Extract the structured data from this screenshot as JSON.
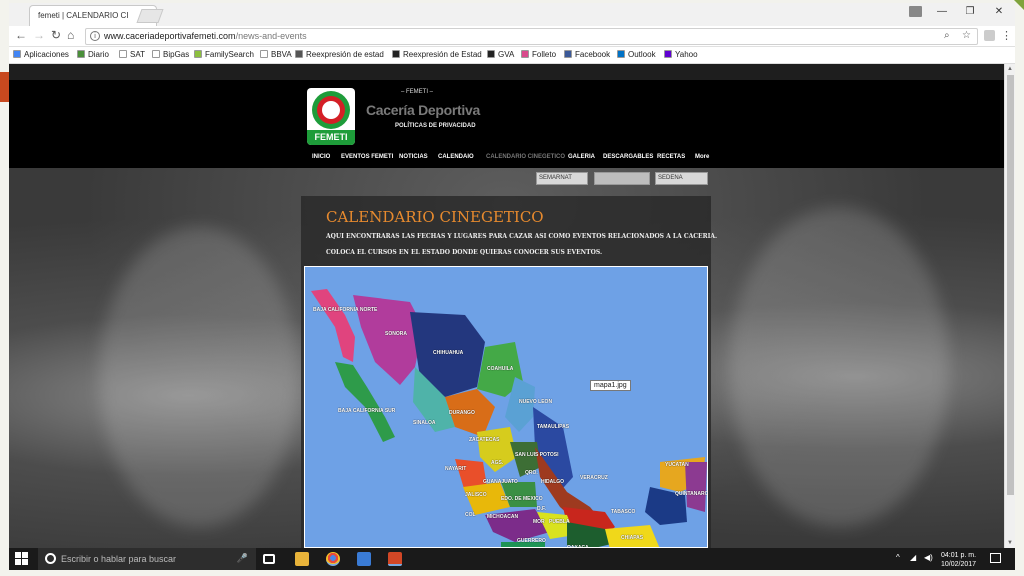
{
  "browser": {
    "tab_title": "femeti | CALENDARIO CI",
    "tab_close": "×",
    "url_host": "www.caceriadeportivafemeti.com",
    "url_path": "/news-and-events",
    "window_controls": {
      "minimize": "—",
      "restore": "❐",
      "close": "✕"
    }
  },
  "bookmarks": [
    {
      "label": "Aplicaciones",
      "icon": "apps-grid-icon",
      "color": "#4285f4"
    },
    {
      "label": "Diario",
      "icon": "globe-icon",
      "color": "#4a8f3a"
    },
    {
      "label": "SAT",
      "icon": "page-icon",
      "color": "#ffffff"
    },
    {
      "label": "BipGas",
      "icon": "page-icon",
      "color": "#ffffff"
    },
    {
      "label": "FamilySearch",
      "icon": "tree-icon",
      "color": "#8cbf3f"
    },
    {
      "label": "BBVA",
      "icon": "page-icon",
      "color": "#ffffff"
    },
    {
      "label": "Reexpresión de estad",
      "icon": "refresh-icon",
      "color": "#555555"
    },
    {
      "label": "Reexpresión de Estad",
      "icon": "github-icon",
      "color": "#222222"
    },
    {
      "label": "GVA",
      "icon": "gva-icon",
      "color": "#222222"
    },
    {
      "label": "Folleto",
      "icon": "mk-icon",
      "color": "#d94a8c"
    },
    {
      "label": "Facebook",
      "icon": "facebook-icon",
      "color": "#3b5998"
    },
    {
      "label": "Outlook",
      "icon": "outlook-icon",
      "color": "#0072c6"
    },
    {
      "label": "Yahoo",
      "icon": "yahoo-icon",
      "color": "#5f01d1"
    }
  ],
  "site": {
    "logo_text": "FEMETI",
    "tagline": "– FEMETI –",
    "name": "Cacería Deportiva",
    "privacy": "POLÍTICAS DE PRIVACIDAD",
    "nav": [
      "INICIO",
      "EVENTOS FEMETI",
      "NOTICIAS",
      "CALENDAIO",
      "CALENDARIO CINEGETICO",
      "GALERIA",
      "DESCARGABLES",
      "RECETAS",
      "More"
    ],
    "sponsors": [
      "SEMARNAT",
      "",
      "SEDENA"
    ]
  },
  "page": {
    "title": "CALENDARIO CINEGETICO",
    "line1": "AQUI ENCONTRARAS LAS FECHAS Y LUGARES PARA CAZAR ASI COMO EVENTOS RELACIONADOS A LA CACERIA.",
    "line2": "COLOCA EL CURSOS EN EL ESTADO DONDE QUIERAS CONOCER SUS EVENTOS.",
    "map_tooltip": "mapa1.jpg",
    "map_states": [
      "BAJA CALIFORNIA NORTE",
      "SONORA",
      "CHIHUAHUA",
      "COAHUILA",
      "NUEVO LEON",
      "BAJA CALIFORNIA SUR",
      "DURANGO",
      "SINALOA",
      "TAMAULIPAS",
      "ZACATECAS",
      "AGS.",
      "SAN LUIS POTOSI",
      "NAYARIT",
      "GUANAJUATO",
      "QRO.",
      "HIDALGO",
      "VERACRUZ",
      "YUCATAN",
      "QUINTANAROO",
      "JALISCO",
      "EDO. DE MEXICO",
      "D.F.",
      "COL",
      "MICHOACAN",
      "MOR",
      "PUEBLA",
      "TABASCO",
      "CHIAPAS",
      "GUERRERO",
      "OAXACA"
    ]
  },
  "taskbar": {
    "search_placeholder": "Escribir o hablar para buscar",
    "time": "04:01 p. m.",
    "date": "10/02/2017"
  }
}
